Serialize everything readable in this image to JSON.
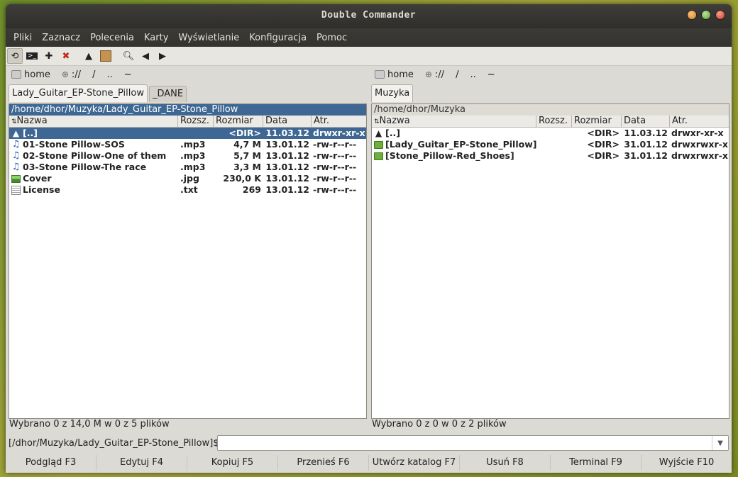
{
  "window": {
    "title": "Double Commander"
  },
  "menu": [
    "Pliki",
    "Zaznacz",
    "Polecenia",
    "Karty",
    "Wyświetlanie",
    "Konfiguracja",
    "Pomoc"
  ],
  "toolbar_icons": [
    "refresh-icon",
    "terminal-icon",
    "plus-icon",
    "delete-icon",
    "up-arrow-icon",
    "archive-icon",
    "search-icon",
    "back-icon",
    "forward-icon"
  ],
  "left": {
    "drivebar": {
      "home": "home",
      "net": "://",
      "root": "/",
      "parent": "..",
      "tilde": "~"
    },
    "tabs": [
      "Lady_Guitar_EP-Stone_Pillow",
      "_DANE"
    ],
    "path": "/home/dhor/Muzyka/Lady_Guitar_EP-Stone_Pillow",
    "columns": {
      "name": "Nazwa",
      "ext": "Rozsz.",
      "size": "Rozmiar",
      "date": "Data",
      "attr": "Atr."
    },
    "files": [
      {
        "icon": "up",
        "name": "[..]",
        "ext": "",
        "size": "<DIR>",
        "date": "11.03.12",
        "attr": "drwxr-xr-x",
        "selected": true
      },
      {
        "icon": "music",
        "name": "01-Stone Pillow-SOS",
        "ext": ".mp3",
        "size": "4,7 M",
        "date": "13.01.12",
        "attr": "-rw-r--r--"
      },
      {
        "icon": "music",
        "name": "02-Stone Pillow-One of them",
        "ext": ".mp3",
        "size": "5,7 M",
        "date": "13.01.12",
        "attr": "-rw-r--r--"
      },
      {
        "icon": "music",
        "name": "03-Stone Pillow-The race",
        "ext": ".mp3",
        "size": "3,3 M",
        "date": "13.01.12",
        "attr": "-rw-r--r--"
      },
      {
        "icon": "img",
        "name": "Cover",
        "ext": ".jpg",
        "size": "230,0 K",
        "date": "13.01.12",
        "attr": "-rw-r--r--"
      },
      {
        "icon": "txt",
        "name": "License",
        "ext": ".txt",
        "size": "269",
        "date": "13.01.12",
        "attr": "-rw-r--r--"
      }
    ],
    "status": "Wybrano 0 z 14,0 M w 0 z 5 plików"
  },
  "right": {
    "drivebar": {
      "home": "home",
      "net": "://",
      "root": "/",
      "parent": "..",
      "tilde": "~"
    },
    "tabs": [
      "Muzyka"
    ],
    "path": "/home/dhor/Muzyka",
    "columns": {
      "name": "Nazwa",
      "ext": "Rozsz.",
      "size": "Rozmiar",
      "date": "Data",
      "attr": "Atr."
    },
    "files": [
      {
        "icon": "up",
        "name": "[..]",
        "ext": "",
        "size": "<DIR>",
        "date": "11.03.12",
        "attr": "drwxr-xr-x"
      },
      {
        "icon": "folder",
        "name": "[Lady_Guitar_EP-Stone_Pillow]",
        "ext": "",
        "size": "<DIR>",
        "date": "31.01.12",
        "attr": "drwxrwxr-x"
      },
      {
        "icon": "folder",
        "name": "[Stone_Pillow-Red_Shoes]",
        "ext": "",
        "size": "<DIR>",
        "date": "31.01.12",
        "attr": "drwxrwxr-x"
      }
    ],
    "status": "Wybrano 0 z 0 w 0 z 2 plików"
  },
  "cmdline": {
    "prompt": "[/dhor/Muzyka/Lady_Guitar_EP-Stone_Pillow]$:",
    "value": ""
  },
  "fkeys": [
    "Podgląd F3",
    "Edytuj F4",
    "Kopiuj F5",
    "Przenieś F6",
    "Utwórz katalog F7",
    "Usuń F8",
    "Terminal F9",
    "Wyjście F10"
  ]
}
